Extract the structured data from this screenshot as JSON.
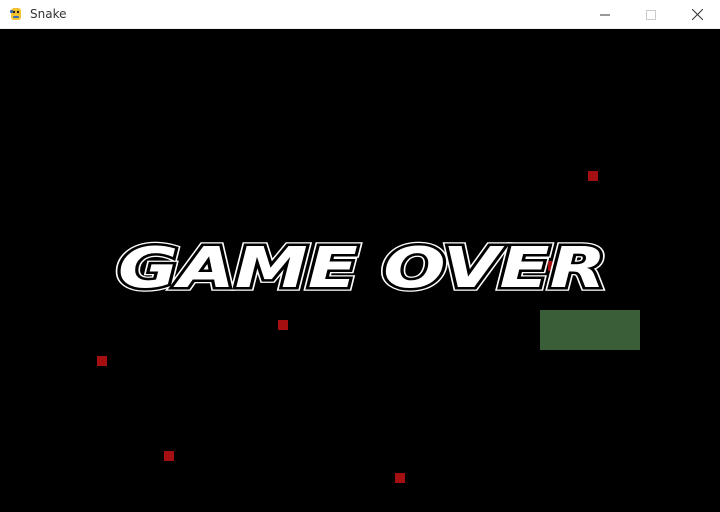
{
  "window": {
    "title": "Snake",
    "icon": "python-snake-icon"
  },
  "controls": {
    "minimize": "minimize-icon",
    "maximize": "maximize-icon",
    "close": "close-icon"
  },
  "game": {
    "message": "GAME OVER",
    "food_color": "#a50f0f",
    "snake_color": "#3a5e37",
    "background": "#000000"
  }
}
